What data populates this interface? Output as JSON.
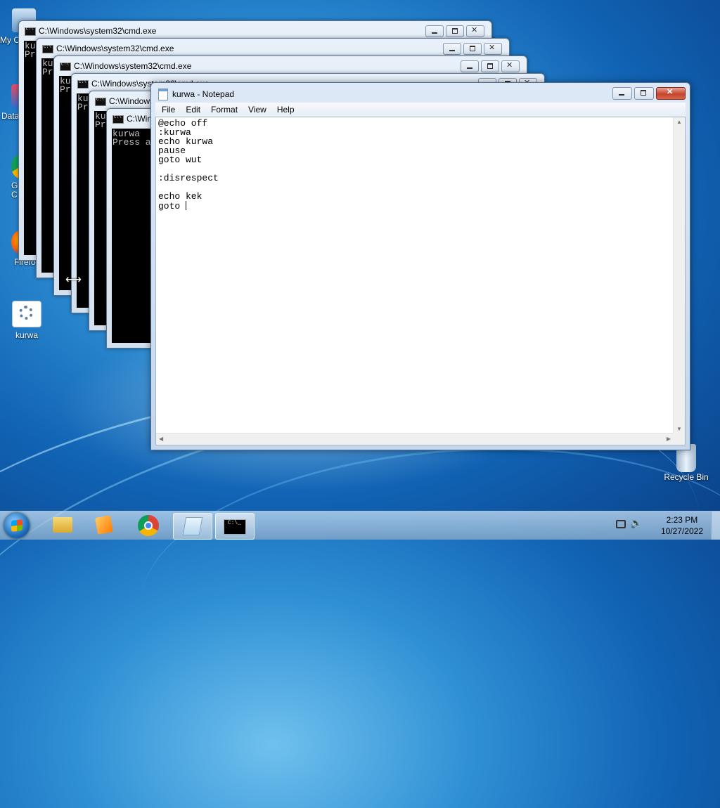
{
  "desktop": {
    "icons": [
      {
        "label": "My C"
      },
      {
        "label": "Data"
      },
      {
        "label": "G C"
      },
      {
        "label": "Firefo"
      },
      {
        "label": "kurwa"
      },
      {
        "label": "Recycle Bin"
      }
    ]
  },
  "cmd_windows": [
    {
      "title": "C:\\Windows\\system32\\cmd.exe",
      "body": "ku\nPr"
    },
    {
      "title": "C:\\Windows\\system32\\cmd.exe",
      "body": "ku\nPr"
    },
    {
      "title": "C:\\Windows\\system32\\cmd.exe",
      "body": "ku\nPr"
    },
    {
      "title": "C:\\Windows\\system32\\cmd.exe",
      "body": "ku\nPr"
    },
    {
      "title": "C:\\Windows",
      "body": "ku\nPr"
    },
    {
      "title": "C:\\Win",
      "body": "kurwa\nPress a"
    }
  ],
  "notepad": {
    "title": "kurwa - Notepad",
    "menu": [
      "File",
      "Edit",
      "Format",
      "View",
      "Help"
    ],
    "content": "@echo off\n:kurwa\necho kurwa\npause\ngoto wut\n\n:disrespect\n\necho kek\ngoto "
  },
  "taskbar": {
    "time": "2:23 PM",
    "date": "10/27/2022",
    "apps": [
      {
        "icon": "explorer-icon"
      },
      {
        "icon": "media-player-icon"
      },
      {
        "icon": "chrome-icon"
      },
      {
        "icon": "notepad-icon"
      },
      {
        "icon": "cmd-icon"
      }
    ]
  }
}
